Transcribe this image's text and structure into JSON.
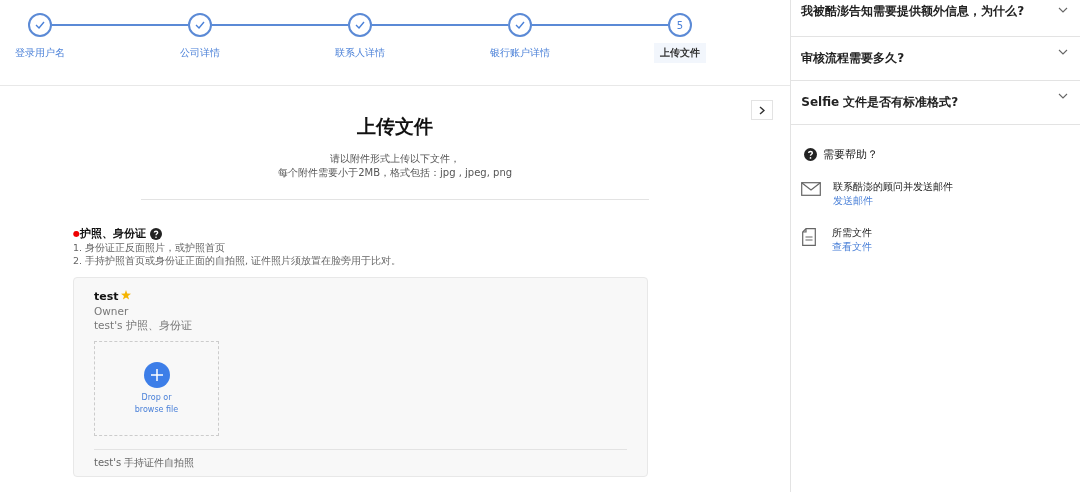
{
  "steps": [
    {
      "label": "登录用户名",
      "completed": true,
      "selected": false
    },
    {
      "label": "公司详情",
      "completed": true,
      "selected": false
    },
    {
      "label": "联系人详情",
      "completed": true,
      "selected": false
    },
    {
      "label": "银行账户详情",
      "completed": true,
      "selected": false
    },
    {
      "label": "上传文件",
      "number": "5",
      "completed": false,
      "selected": true
    }
  ],
  "page": {
    "title": "上传文件",
    "description": [
      "请以附件形式上传以下文件，",
      "每个附件需要小于2MB，格式包括：jpg , jpeg, png"
    ]
  },
  "section": {
    "required_mark": "●",
    "title": "护照、身份证",
    "instructions": [
      "1. 身份证正反面照片，或护照首页",
      "2. 手持护照首页或身份证正面的自拍照, 证件照片须放置在脸旁用于比对。"
    ],
    "card": {
      "name": "test",
      "starred": true,
      "role": "Owner",
      "document": "test's 护照、身份证",
      "dropzone": [
        "Drop or",
        "browse file"
      ],
      "next_document": "test's 手持证件自拍照"
    }
  },
  "faq": [
    {
      "question": "我被酷澎告知需要提供额外信息，为什么?",
      "expanded": false
    },
    {
      "question": "审核流程需要多久?",
      "expanded": false
    },
    {
      "question": "Selfie 文件是否有标准格式?",
      "expanded": false
    }
  ],
  "help": {
    "title": "需要帮助？",
    "items": [
      {
        "kind": "mail",
        "title": "联系酷澎的顾问并发送邮件",
        "link": "发送邮件"
      },
      {
        "kind": "document",
        "title": "所需文件",
        "link": "查看文件"
      }
    ]
  }
}
